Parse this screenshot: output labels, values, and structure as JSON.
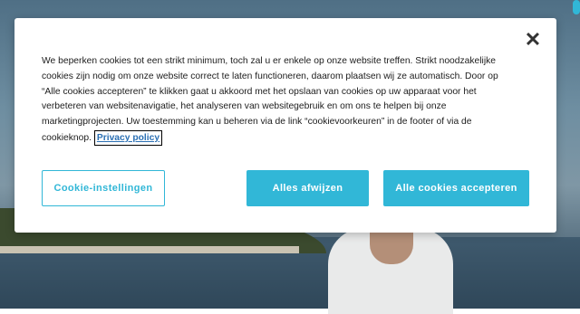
{
  "modal": {
    "close_symbol": "✕",
    "text": "We beperken cookies tot een strikt minimum, toch zal u er enkele op onze website treffen. Strikt noodzakelijke cookies zijn nodig om onze website correct te laten functioneren, daarom plaatsen wij ze automatisch. Door op “Alle cookies accepteren” te klikken gaat u akkoord met het opslaan van cookies op uw apparaat voor het verbeteren van websitenavigatie, het analyseren van websitegebruik en om ons te helpen bij onze marketingprojecten. Uw toestemming kan u beheren via de link “cookievoorkeuren” in de footer of via de cookieknop.",
    "policy_link": "Privacy policy",
    "buttons": {
      "settings": "Cookie-instellingen",
      "reject": "Alles afwijzen",
      "accept": "Alle cookies accepteren"
    }
  },
  "colors": {
    "accent": "#31b7d7",
    "link": "#2a6fb3",
    "text": "#1c1c1c"
  },
  "icons": {
    "close": "close-icon"
  }
}
